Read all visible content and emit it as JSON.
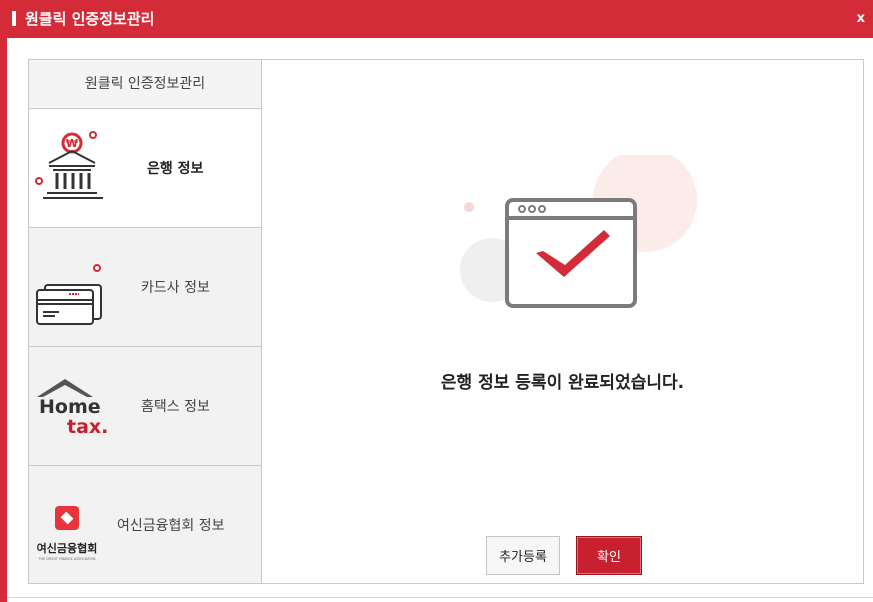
{
  "window": {
    "title": "원클릭 인증정보관리",
    "close_label": "x"
  },
  "sidebar": {
    "header": "원클릭 인증정보관리",
    "items": [
      {
        "label": "은행 정보",
        "icon": "bank-icon",
        "active": true
      },
      {
        "label": "카드사 정보",
        "icon": "credit-card-icon",
        "active": false
      },
      {
        "label": "홈택스 정보",
        "icon": "hometax-logo-icon",
        "active": false
      },
      {
        "label": "여신금융협회 정보",
        "icon": "credit-finance-association-logo-icon",
        "active": false
      }
    ],
    "hometax_logo": {
      "line1": "Home",
      "line2": "tax."
    },
    "cfa_logo": {
      "name": "여신금융협회",
      "subtitle": "THE CREDIT FINANCE ASSOCIATION"
    }
  },
  "content": {
    "message": "은행 정보 등록이 완료되었습니다.",
    "illustration": "browser-window-checkmark-icon"
  },
  "buttons": {
    "add": "추가등록",
    "confirm": "확인"
  },
  "colors": {
    "accent": "#d42b38",
    "confirm": "#c9202f",
    "text": "#222222"
  }
}
